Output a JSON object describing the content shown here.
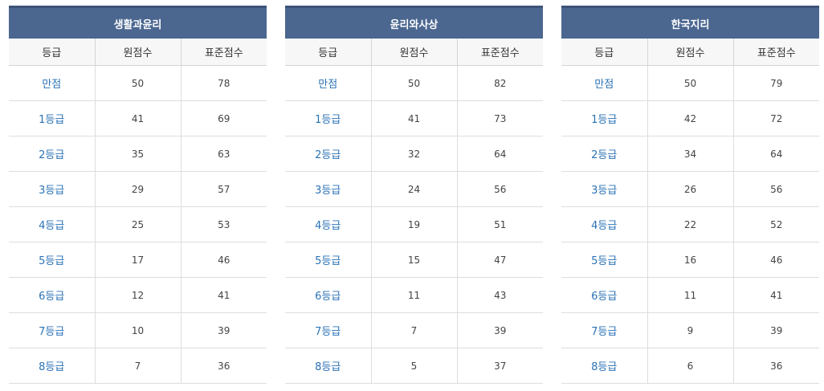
{
  "columns": [
    "등급",
    "원점수",
    "표준점수"
  ],
  "tables": [
    {
      "subject": "생활과윤리",
      "rows": [
        {
          "grade": "만점",
          "raw": "50",
          "standard": "78"
        },
        {
          "grade": "1등급",
          "raw": "41",
          "standard": "69"
        },
        {
          "grade": "2등급",
          "raw": "35",
          "standard": "63"
        },
        {
          "grade": "3등급",
          "raw": "29",
          "standard": "57"
        },
        {
          "grade": "4등급",
          "raw": "25",
          "standard": "53"
        },
        {
          "grade": "5등급",
          "raw": "17",
          "standard": "46"
        },
        {
          "grade": "6등급",
          "raw": "12",
          "standard": "41"
        },
        {
          "grade": "7등급",
          "raw": "10",
          "standard": "39"
        },
        {
          "grade": "8등급",
          "raw": "7",
          "standard": "36"
        }
      ]
    },
    {
      "subject": "윤리와사상",
      "rows": [
        {
          "grade": "만점",
          "raw": "50",
          "standard": "82"
        },
        {
          "grade": "1등급",
          "raw": "41",
          "standard": "73"
        },
        {
          "grade": "2등급",
          "raw": "32",
          "standard": "64"
        },
        {
          "grade": "3등급",
          "raw": "24",
          "standard": "56"
        },
        {
          "grade": "4등급",
          "raw": "19",
          "standard": "51"
        },
        {
          "grade": "5등급",
          "raw": "15",
          "standard": "47"
        },
        {
          "grade": "6등급",
          "raw": "11",
          "standard": "43"
        },
        {
          "grade": "7등급",
          "raw": "7",
          "standard": "39"
        },
        {
          "grade": "8등급",
          "raw": "5",
          "standard": "37"
        }
      ]
    },
    {
      "subject": "한국지리",
      "rows": [
        {
          "grade": "만점",
          "raw": "50",
          "standard": "79"
        },
        {
          "grade": "1등급",
          "raw": "42",
          "standard": "72"
        },
        {
          "grade": "2등급",
          "raw": "34",
          "standard": "64"
        },
        {
          "grade": "3등급",
          "raw": "26",
          "standard": "56"
        },
        {
          "grade": "4등급",
          "raw": "22",
          "standard": "52"
        },
        {
          "grade": "5등급",
          "raw": "16",
          "standard": "46"
        },
        {
          "grade": "6등급",
          "raw": "11",
          "standard": "41"
        },
        {
          "grade": "7등급",
          "raw": "9",
          "standard": "39"
        },
        {
          "grade": "8등급",
          "raw": "6",
          "standard": "36"
        }
      ]
    }
  ],
  "colors": {
    "header_bg": "#4b6790",
    "grade_text": "#2a72b5"
  }
}
